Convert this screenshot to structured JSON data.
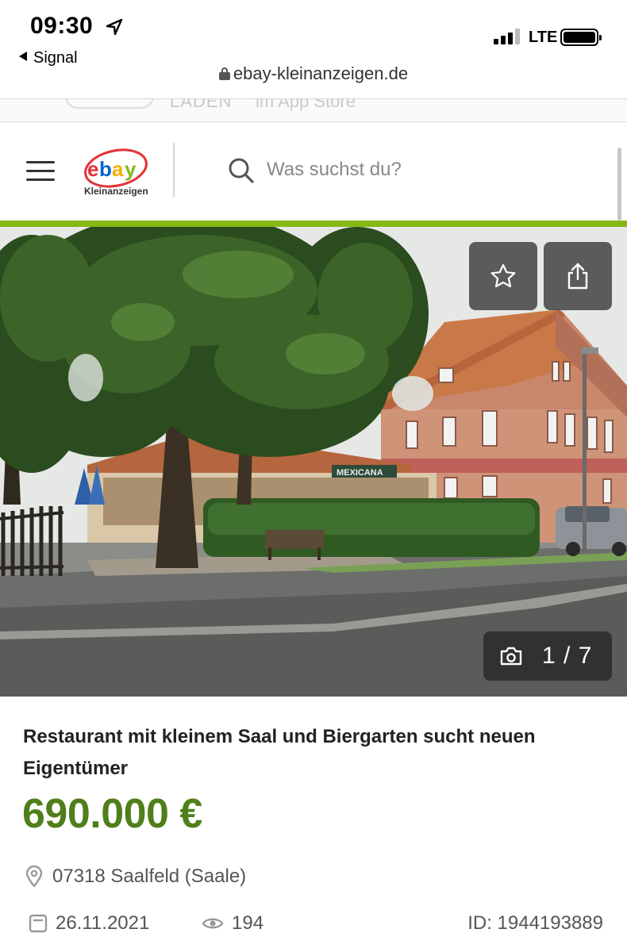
{
  "status_bar": {
    "time": "09:30",
    "back_app": "Signal",
    "network": "LTE"
  },
  "browser": {
    "url": "ebay-kleinanzeigen.de"
  },
  "app_banner": {
    "text_left": "LADEN",
    "text_right": "im App Store"
  },
  "header": {
    "logo_sub": "Kleinanzeigen",
    "search_placeholder": "Was suchst du?",
    "accent_color": "#86b817"
  },
  "gallery": {
    "counter": "1 / 7",
    "sign_text": "MEXICANA"
  },
  "ad": {
    "title": "Restaurant mit kleinem Saal und Biergarten sucht neuen Eigentümer",
    "price": "690.000 €",
    "price_color": "#4f7f1a",
    "location": "07318 Saalfeld (Saale)",
    "date": "26.11.2021",
    "views": "194",
    "id": "ID: 1944193889"
  },
  "icons": [
    "location-arrow-icon",
    "lock-icon",
    "menu-icon",
    "search-icon",
    "star-icon",
    "share-icon",
    "camera-icon",
    "map-pin-icon",
    "calendar-icon",
    "eye-icon"
  ]
}
